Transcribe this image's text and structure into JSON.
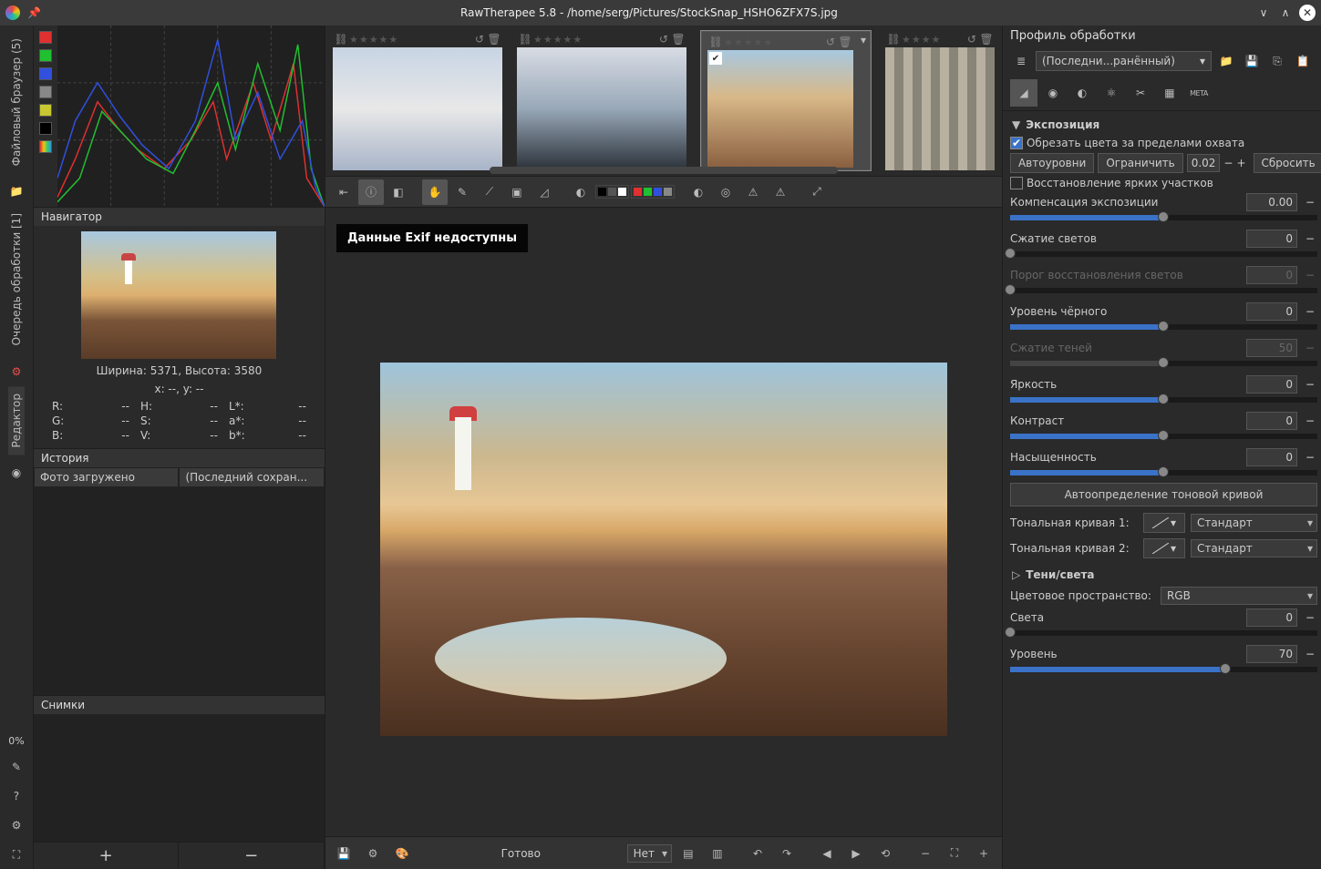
{
  "title": "RawTherapee 5.8 - /home/serg/Pictures/StockSnap_HSHO6ZFX7S.jpg",
  "left_tabs": {
    "file_browser": "Файловый браузер (5)",
    "queue": "Очередь обработки [1]",
    "editor": "Редактор",
    "pct": "0%"
  },
  "histo_colors": [
    "#e03030",
    "#20c030",
    "#3050e0",
    "#888",
    "#c8c830",
    "#000",
    "#555"
  ],
  "navigator": {
    "title": "Навигатор",
    "dims": "Ширина: 5371, Высота: 3580",
    "xy": "x: --, y: --",
    "rows": [
      [
        "R:",
        "--",
        "H:",
        "--",
        "L*:",
        "--"
      ],
      [
        "G:",
        "--",
        "S:",
        "--",
        "a*:",
        "--"
      ],
      [
        "B:",
        "--",
        "V:",
        "--",
        "b*:",
        "--"
      ]
    ]
  },
  "history": {
    "title": "История",
    "c1": "Фото загружено",
    "c2": "(Последний сохран..."
  },
  "snapshots": {
    "title": "Снимки"
  },
  "bottombar": {
    "status": "Готово",
    "rot": "Нет"
  },
  "exif_banner": "Данные Exif недоступны",
  "rp": {
    "profile_title": "Профиль обработки",
    "profile_sel": "(Последни...ранённый)",
    "section_exposure": "Экспозиция",
    "clip_cb": "Обрезать цвета за пределами охвата",
    "auto": "Автоуровни",
    "clip": "Ограничить",
    "clip_val": "0.02",
    "reset": "Сбросить",
    "hl_recover": "Восстановление ярких участков",
    "sliders": [
      {
        "label": "Компенсация экспозиции",
        "val": "0.00",
        "pct": 50,
        "dis": false
      },
      {
        "label": "Сжатие светов",
        "val": "0",
        "pct": 0,
        "dis": false
      },
      {
        "label": "Порог восстановления светов",
        "val": "0",
        "pct": 0,
        "dis": true
      },
      {
        "label": "Уровень чёрного",
        "val": "0",
        "pct": 50,
        "dis": false
      },
      {
        "label": "Сжатие теней",
        "val": "50",
        "pct": 50,
        "dis": true
      },
      {
        "label": "Яркость",
        "val": "0",
        "pct": 50,
        "dis": false
      },
      {
        "label": "Контраст",
        "val": "0",
        "pct": 50,
        "dis": false
      },
      {
        "label": "Насыщенность",
        "val": "0",
        "pct": 50,
        "dis": false
      }
    ],
    "auto_curve": "Автоопределение тоновой кривой",
    "tc1": "Тональная кривая 1:",
    "tc2": "Тональная кривая 2:",
    "mode": "Стандарт",
    "section_shadows": "Тени/света",
    "colorspace_lbl": "Цветовое пространство:",
    "colorspace": "RGB",
    "sh_sliders": [
      {
        "label": "Света",
        "val": "0",
        "pct": 0
      },
      {
        "label": "Уровень",
        "val": "70",
        "pct": 70
      }
    ]
  }
}
